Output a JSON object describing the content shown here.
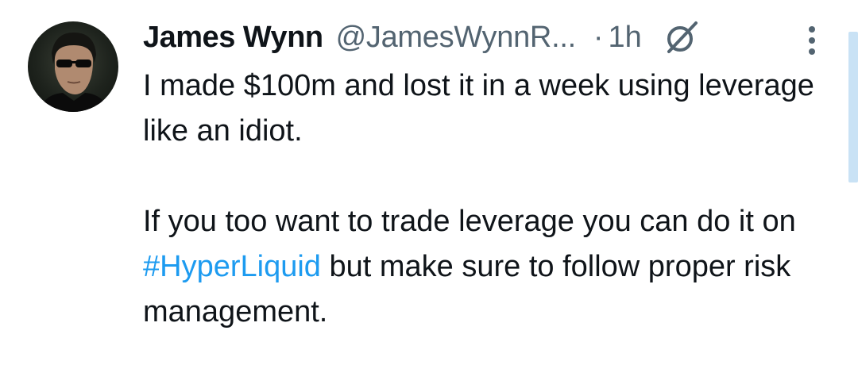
{
  "tweet": {
    "author": {
      "display_name": "James Wynn",
      "handle": "@JamesWynnR..."
    },
    "separator": "·",
    "time": "1h",
    "text": {
      "line1": "I made $100m and lost it in a week using leverage like an idiot.",
      "line2_before": "If you too want to trade leverage you can do it on ",
      "hashtag": "#HyperLiquid",
      "line2_after": " but make sure to follow proper risk management."
    },
    "icons": {
      "grok": "grok-icon",
      "more": "more-vertical-icon",
      "avatar": "avatar"
    },
    "colors": {
      "text": "#0f1419",
      "secondary": "#536471",
      "link": "#1d9bf0"
    }
  }
}
